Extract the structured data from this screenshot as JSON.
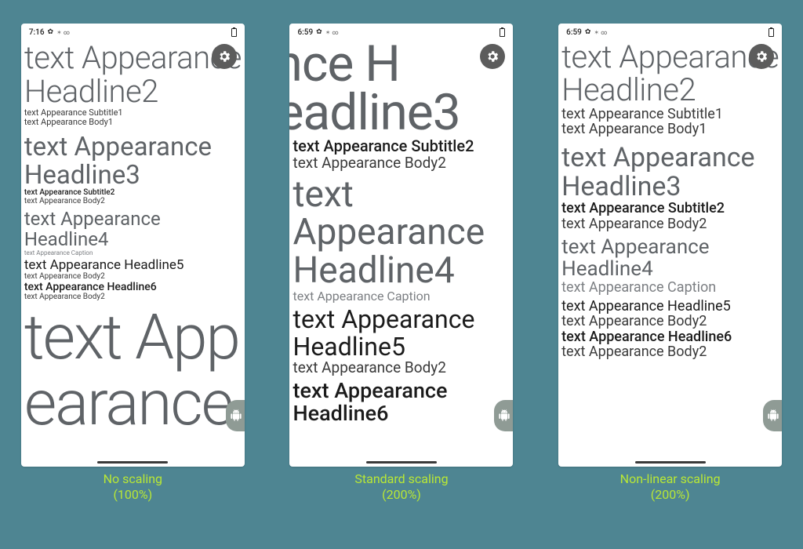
{
  "phone1": {
    "time": "7:16",
    "statusIcons": "✶  ∞",
    "lines": {
      "h2": "text Appearance Headline2",
      "sub1": "text Appearance Subtitle1",
      "body1": "text Appearance Body1",
      "h3": "text Appearance Headline3",
      "sub2": "text Appearance Subtitle2",
      "body2a": "text Appearance Body2",
      "h4": "text Appearance Headline4",
      "cap": "text Appearance Caption",
      "h5": "text Appearance Headline5",
      "body2b": "text Appearance Body2",
      "h6": "text Appearance Headline6",
      "body2c": "text Appearance Body2",
      "giant1": "text App",
      "giant2": "earance"
    },
    "caption_line1": "No scaling",
    "caption_line2": "(100%)"
  },
  "phone2": {
    "time": "6:59",
    "statusIcons": "✶  ∞",
    "lines": {
      "h3a": "arance H",
      "h3b": "eadline3",
      "sub2": "text Appearance Subtitle2",
      "body2a": "text Appearance Body2",
      "h4": "text Appearance Headline4",
      "cap": "text Appearance Caption",
      "h5": "text Appearance Headline5",
      "body2b": "text Appearance Body2",
      "h6": "text Appearance Headline6"
    },
    "caption_line1": "Standard scaling",
    "caption_line2": "(200%)"
  },
  "phone3": {
    "time": "6:59",
    "statusIcons": "✶  ∞",
    "lines": {
      "h2": "text Appearance Headline2",
      "sub1": "text Appearance Subtitle1",
      "body1": "text Appearance Body1",
      "h3": "text Appearance Headline3",
      "sub2": "text Appearance Subtitle2",
      "body2a": "text Appearance Body2",
      "h4": "text Appearance Headline4",
      "cap": "text Appearance Caption",
      "h5": "text Appearance Headline5",
      "body2b": "text Appearance Body2",
      "h6": "text Appearance Headline6",
      "body2c": "text Appearance Body2"
    },
    "caption_line1": "Non-linear scaling",
    "caption_line2": "(200%)"
  }
}
